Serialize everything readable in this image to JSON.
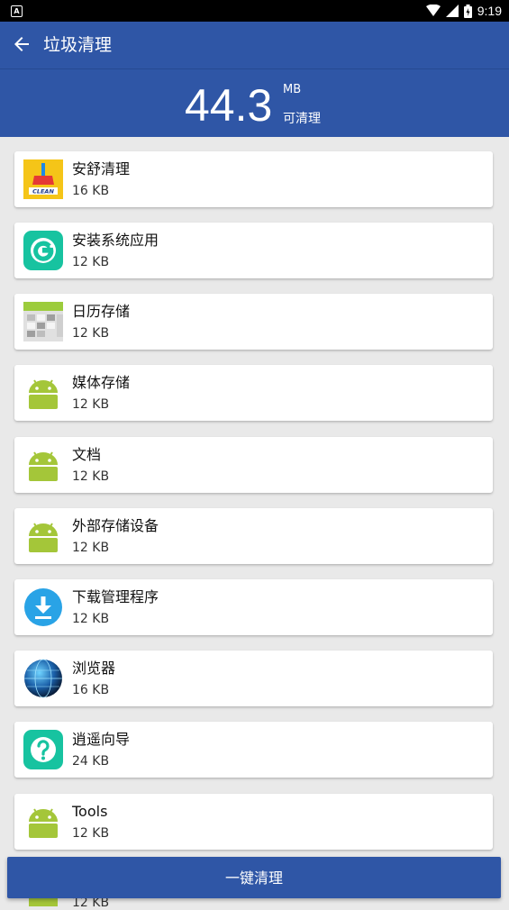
{
  "status_bar": {
    "time": "9:19",
    "notification_icon": "A"
  },
  "app_bar": {
    "back_icon": "arrow-left-icon",
    "title": "垃圾清理"
  },
  "summary": {
    "size": "44.3",
    "unit": "MB",
    "caption": "可清理"
  },
  "colors": {
    "primary": "#2f56a6",
    "android_green": "#a4c639"
  },
  "items": [
    {
      "name": "安舒清理",
      "size": "16 KB",
      "icon": "clean-app-icon"
    },
    {
      "name": "安装系统应用",
      "size": "12 KB",
      "icon": "g-app-icon"
    },
    {
      "name": "日历存储",
      "size": "12 KB",
      "icon": "calendar-icon"
    },
    {
      "name": "媒体存储",
      "size": "12 KB",
      "icon": "android-icon"
    },
    {
      "name": "文档",
      "size": "12 KB",
      "icon": "android-icon"
    },
    {
      "name": "外部存储设备",
      "size": "12 KB",
      "icon": "android-icon"
    },
    {
      "name": "下载管理程序",
      "size": "12 KB",
      "icon": "download-icon"
    },
    {
      "name": "浏览器",
      "size": "16 KB",
      "icon": "globe-icon"
    },
    {
      "name": "逍遥向导",
      "size": "24 KB",
      "icon": "help-icon"
    },
    {
      "name": "Tools",
      "size": "12 KB",
      "icon": "android-icon"
    }
  ],
  "peek_item": {
    "size": "12 KB"
  },
  "action": {
    "label": "一键清理"
  }
}
